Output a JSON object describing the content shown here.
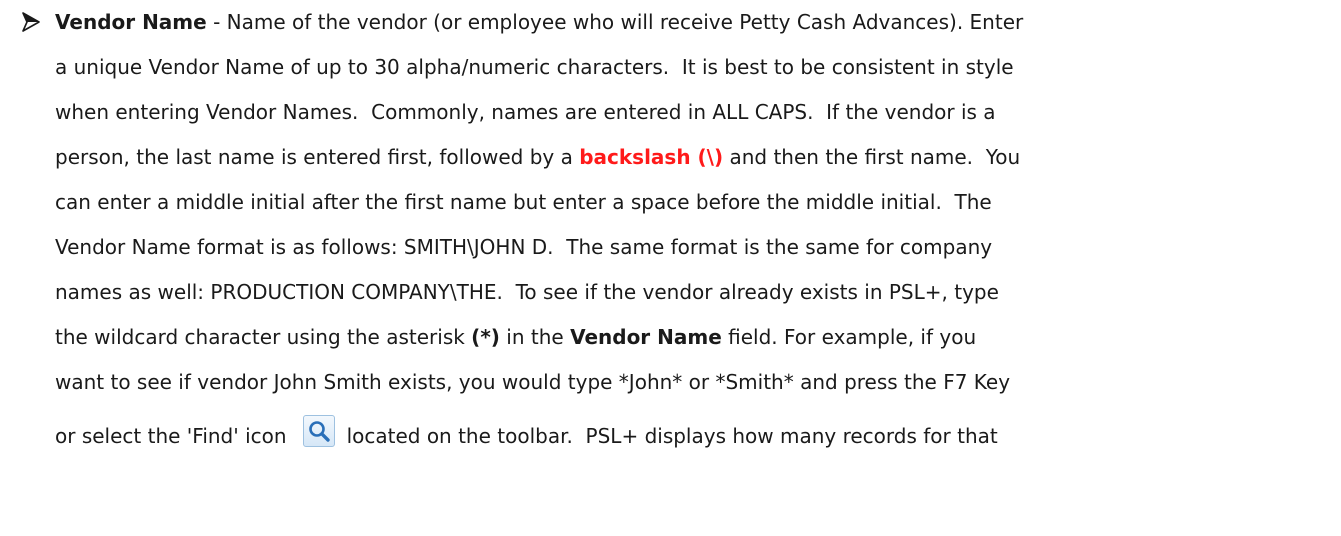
{
  "colors": {
    "text": "#1a1a1a",
    "highlight": "#ff1a1a",
    "icon_blue": "#2a6fb8"
  },
  "bullet_icon": "arrow-bullet-icon",
  "find_icon": "magnifier-search-icon",
  "lines": [
    [
      {
        "text": "Vendor Name",
        "style": "b"
      },
      {
        "text": " - Name of the vendor (or employee who will receive Petty Cash Advances). Enter"
      }
    ],
    [
      {
        "text": "a unique Vendor Name of up to 30 alpha/numeric characters.  It is best to be consistent in style"
      }
    ],
    [
      {
        "text": "when entering Vendor Names.  Commonly, names are entered in ALL CAPS.  If the vendor is a"
      }
    ],
    [
      {
        "text": "person, the last name is entered first, followed by a "
      },
      {
        "text": "backslash (\\)",
        "style": "red"
      },
      {
        "text": " and then the first name.  You"
      }
    ],
    [
      {
        "text": "can enter a middle initial after the first name but enter a space before the middle initial.  The"
      }
    ],
    [
      {
        "text": "Vendor Name format is as follows: SMITH\\JOHN D.  The same format is the same for company"
      }
    ],
    [
      {
        "text": "names as well: PRODUCTION COMPANY\\THE.  To see if the vendor already exists in PSL+, type"
      }
    ],
    [
      {
        "text": "the wildcard character using the asterisk "
      },
      {
        "text": "(*)",
        "style": "b"
      },
      {
        "text": " in the "
      },
      {
        "text": "Vendor Name",
        "style": "b"
      },
      {
        "text": " field. For example, if you"
      }
    ],
    [
      {
        "text": "want to see if vendor John Smith exists, you would type *John* or *Smith* and press the F7 Key"
      }
    ],
    [
      {
        "text": "or select the 'Find' icon"
      },
      {
        "icon": true
      },
      {
        "text": "located on the toolbar.  PSL+ displays how many records for that"
      }
    ]
  ]
}
